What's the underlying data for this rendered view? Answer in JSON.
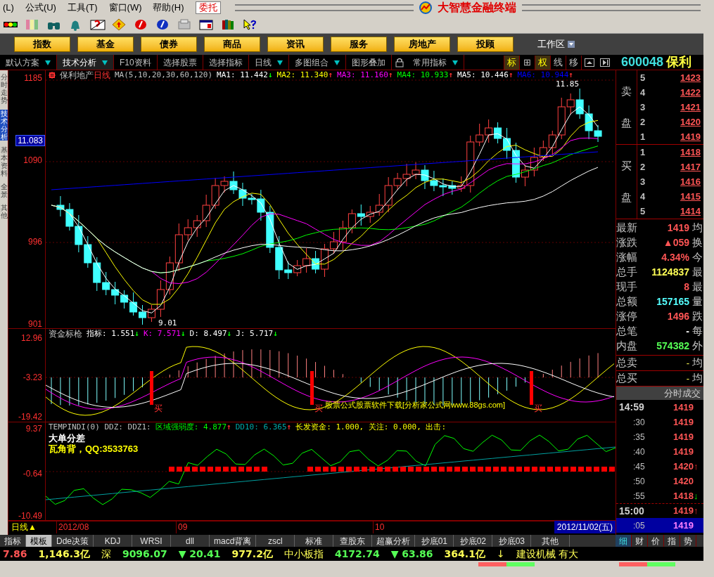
{
  "menu": {
    "items": [
      "(L)",
      "公式(U)",
      "工具(T)",
      "窗口(W)",
      "帮助(H)"
    ],
    "trade_button": "委托"
  },
  "window": {
    "title": "大智慧金融终端"
  },
  "nav_buttons": [
    "指数",
    "基金",
    "债券",
    "商品",
    "资讯",
    "服务",
    "房地产",
    "投顾"
  ],
  "workspace": {
    "label": "工作区"
  },
  "tabs": [
    {
      "label": "默认方案",
      "dropdown": true,
      "selected": false
    },
    {
      "label": "技术分析",
      "dropdown": true,
      "selected": true
    },
    {
      "label": "F10资料",
      "dropdown": false,
      "selected": false
    },
    {
      "label": "选择股票",
      "dropdown": false,
      "selected": false
    },
    {
      "label": "选择指标",
      "dropdown": false,
      "selected": false
    },
    {
      "label": "日线",
      "dropdown": true,
      "selected": false
    },
    {
      "label": "多图组合",
      "dropdown": true,
      "selected": false
    },
    {
      "label": "图形叠加",
      "dropdown": false,
      "selected": false
    },
    {
      "label": "常用指标",
      "dropdown": true,
      "selected": false
    }
  ],
  "toggles": [
    {
      "label": "标",
      "on": true
    },
    {
      "label": "⊞",
      "on": false
    },
    {
      "label": "权",
      "on": true
    },
    {
      "label": "线",
      "on": false
    },
    {
      "label": "移",
      "on": false
    }
  ],
  "stock": {
    "code": "600048",
    "name": "保利"
  },
  "side_tabs": [
    {
      "label": "分时走势",
      "selected": false
    },
    {
      "label": "技术分析",
      "selected": true
    },
    {
      "label": "基本资料",
      "selected": false
    },
    {
      "label": "全景",
      "selected": false
    },
    {
      "label": "其他",
      "selected": false
    }
  ],
  "price_panel": {
    "name": "保利地产",
    "period": "日线",
    "formula": "MA(5,10,20,30,60,120)",
    "series": [
      {
        "label": "MA1: 11.442",
        "arrow": "↓",
        "rising": false,
        "color": "#ffffff"
      },
      {
        "label": "MA2: 11.340",
        "arrow": "↑",
        "rising": true,
        "color": "#ffff00"
      },
      {
        "label": "MA3: 11.160",
        "arrow": "↑",
        "rising": true,
        "color": "#ff00ff"
      },
      {
        "label": "MA4: 10.933",
        "arrow": "↑",
        "rising": true,
        "color": "#00ff00"
      },
      {
        "label": "MA5: 10.446",
        "arrow": "↑",
        "rising": true,
        "color": "#ffffff"
      },
      {
        "label": "MA6: 10.944",
        "arrow": "↑",
        "rising": true,
        "color": "#0000ff"
      }
    ],
    "axis": [
      "1185",
      "1090",
      "996",
      "901"
    ],
    "current_price": "11.083",
    "high_label": "11.85",
    "low_label": "9.01"
  },
  "kdj_panel": {
    "name": "资金标枪",
    "axis": [
      "12.96",
      "-3.23",
      "-19.42"
    ],
    "series": [
      {
        "label": "指标: 1.551",
        "arrow": "↓",
        "rising": false,
        "color": "#ffffff"
      },
      {
        "label": "K: 7.571",
        "arrow": "↓",
        "rising": false,
        "color": "#ff00ff"
      },
      {
        "label": "D: 8.497",
        "arrow": "↓",
        "rising": false,
        "color": "#ffffff"
      },
      {
        "label": "J: 5.717",
        "arrow": "↓",
        "rising": false,
        "color": "#ffffff"
      }
    ],
    "note": "股票公式股票软件下载[分析家公式网www.88gs.com]",
    "signals": [
      "买",
      "买",
      "买"
    ]
  },
  "ddz_panel": {
    "name": "TEMPINDI(0) DDZ: DDZ1:",
    "axis": [
      "9.37",
      "-0.64",
      "-10.49"
    ],
    "series": [
      {
        "label": "区域强弱度: 4.877",
        "arrow": "↑",
        "rising": true,
        "color": "#00ff00"
      },
      {
        "label": "DD10: 6.365",
        "arrow": "↑",
        "rising": true,
        "color": "#00aaaa"
      }
    ],
    "extra": "长发资金: 1.000, 关注: 0.000, 出击:",
    "lines": [
      {
        "text": "大单分差",
        "color": "#ffffff"
      },
      {
        "text": "瓦角背，QQ:3533763",
        "color": "#ffff00"
      }
    ]
  },
  "date_axis": {
    "period": "日线▲",
    "labels": [
      "2012/08",
      "09",
      "10"
    ],
    "current": "2012/11/02(五)"
  },
  "order_book": {
    "sell_label": [
      "卖",
      "盘"
    ],
    "buy_label": [
      "买",
      "盘"
    ],
    "sell": [
      {
        "level": "5",
        "price": "1423"
      },
      {
        "level": "4",
        "price": "1422"
      },
      {
        "level": "3",
        "price": "1421"
      },
      {
        "level": "2",
        "price": "1420"
      },
      {
        "level": "1",
        "price": "1419"
      }
    ],
    "buy": [
      {
        "level": "1",
        "price": "1418"
      },
      {
        "level": "2",
        "price": "1417"
      },
      {
        "level": "3",
        "price": "1416"
      },
      {
        "level": "4",
        "price": "1415"
      },
      {
        "level": "5",
        "price": "1414"
      }
    ]
  },
  "quote": [
    {
      "label": "最新",
      "value": "1419",
      "color": "#ff5555",
      "side": "均"
    },
    {
      "label": "涨跌",
      "value": "▲059",
      "color": "#ff5555",
      "side": "换"
    },
    {
      "label": "涨幅",
      "value": "4.34%",
      "color": "#ff5555",
      "side": "今"
    },
    {
      "label": "总手",
      "value": "1124837",
      "color": "#ffff55",
      "side": "最"
    },
    {
      "label": "现手",
      "value": "8",
      "color": "#ff5555",
      "side": "最"
    },
    {
      "label": "总额",
      "value": "157165",
      "color": "#55ffff",
      "side": "量"
    },
    {
      "label": "涨停",
      "value": "1496",
      "color": "#ff5555",
      "side": "跌"
    },
    {
      "label": "总笔",
      "value": "-",
      "color": "#ffffff",
      "side": "每"
    },
    {
      "label": "内盘",
      "value": "574382",
      "color": "#55ff55",
      "side": "外"
    }
  ],
  "totals": [
    {
      "label": "总卖",
      "value": "-",
      "side": "均"
    },
    {
      "label": "总买",
      "value": "-",
      "side": "均"
    }
  ],
  "ticks_header": "分时成交",
  "ticks": [
    {
      "time": "14:59",
      "major": true,
      "price": "1419",
      "selected": false
    },
    {
      "time": ":30",
      "major": false,
      "price": "1419",
      "selected": false
    },
    {
      "time": ":35",
      "major": false,
      "price": "1419",
      "selected": false
    },
    {
      "time": ":40",
      "major": false,
      "price": "1419",
      "selected": false
    },
    {
      "time": ":45",
      "major": false,
      "price": "1420",
      "arrow": "↑",
      "rising": true,
      "selected": false
    },
    {
      "time": ":50",
      "major": false,
      "price": "1420",
      "selected": false
    },
    {
      "time": ":55",
      "major": false,
      "price": "1418",
      "arrow": "↓",
      "rising": false,
      "selected": false
    },
    {
      "time": "15:00",
      "major": true,
      "price": "1419",
      "arrow": "↑",
      "rising": true,
      "selected": false
    },
    {
      "time": ":05",
      "major": false,
      "price": "1419",
      "selected": true
    }
  ],
  "bottom_tabs": [
    {
      "label": "指标",
      "selected": false
    },
    {
      "label": "模板",
      "selected": true
    },
    {
      "label": "Dde决策",
      "selected": false
    },
    {
      "label": "KDJ",
      "selected": false
    },
    {
      "label": "WRSI",
      "selected": false
    },
    {
      "label": "dll",
      "selected": false
    },
    {
      "label": "macd背离",
      "selected": false
    },
    {
      "label": "zscl",
      "selected": false
    },
    {
      "label": "标准",
      "selected": false
    },
    {
      "label": "查股东",
      "selected": false
    },
    {
      "label": "超赢分析",
      "selected": false
    },
    {
      "label": "抄底01",
      "selected": false
    },
    {
      "label": "抄底02",
      "selected": false
    },
    {
      "label": "抄底03",
      "selected": false
    },
    {
      "label": "其他",
      "selected": false
    }
  ],
  "right_tabs": [
    {
      "label": "细",
      "selected": true
    },
    {
      "label": "财",
      "selected": false
    },
    {
      "label": "价",
      "selected": false
    },
    {
      "label": "指",
      "selected": false
    },
    {
      "label": "势",
      "selected": false
    }
  ],
  "status_bar": [
    {
      "text": "7.86",
      "kind": "index",
      "rising": true
    },
    {
      "text": "1,146.3亿",
      "kind": "amount",
      "rising": false
    },
    {
      "text": "深",
      "kind": "label",
      "rising": false
    },
    {
      "text": "9096.07",
      "kind": "index",
      "rising": false
    },
    {
      "text": "▼ 20.41",
      "kind": "index",
      "rising": false
    },
    {
      "text": "977.2亿",
      "kind": "amount",
      "rising": false
    },
    {
      "text": "中小板指",
      "kind": "label",
      "rising": false
    },
    {
      "text": "4172.74",
      "kind": "index",
      "rising": false
    },
    {
      "text": "▼ 63.86",
      "kind": "index",
      "rising": false
    },
    {
      "text": "364.1亿",
      "kind": "amount",
      "rising": false
    },
    {
      "text": "↓",
      "kind": "label",
      "rising": false
    },
    {
      "text": "建设机械 有大",
      "kind": "label",
      "rising": false
    }
  ]
}
